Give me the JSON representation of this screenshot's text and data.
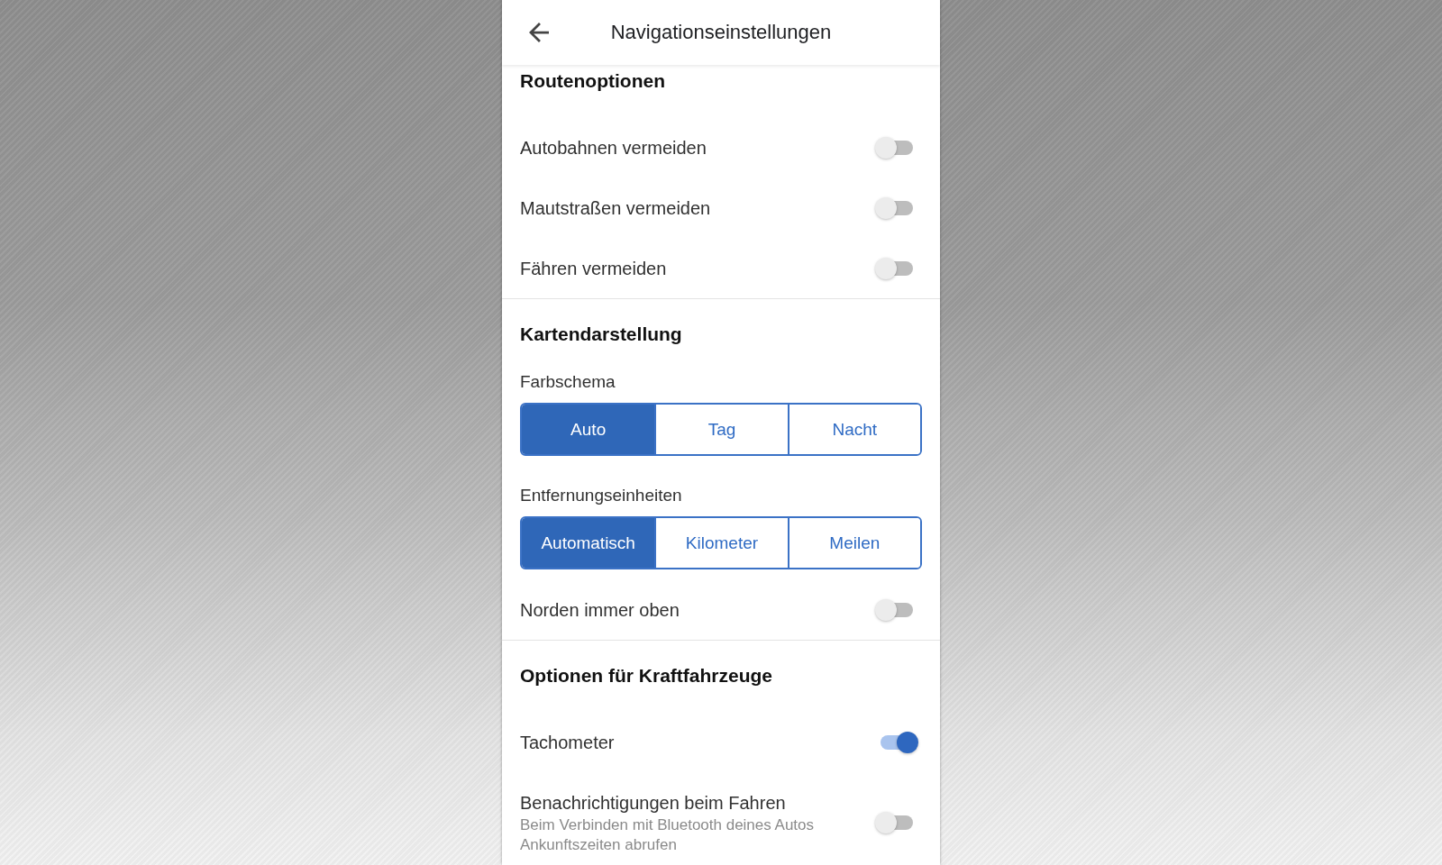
{
  "header": {
    "title": "Navigationseinstellungen"
  },
  "sections": [
    {
      "title": "Routenoptionen",
      "items": [
        {
          "kind": "toggle",
          "label": "Autobahnen vermeiden",
          "on": false
        },
        {
          "kind": "toggle",
          "label": "Mautstraßen vermeiden",
          "on": false
        },
        {
          "kind": "toggle",
          "label": "Fähren vermeiden",
          "on": false
        }
      ]
    },
    {
      "title": "Kartendarstellung",
      "items": [
        {
          "kind": "segmented",
          "label": "Farbschema",
          "options": [
            {
              "label": "Auto",
              "selected": true
            },
            {
              "label": "Tag",
              "selected": false
            },
            {
              "label": "Nacht",
              "selected": false
            }
          ]
        },
        {
          "kind": "segmented",
          "label": "Entfernungseinheiten",
          "options": [
            {
              "label": "Automatisch",
              "selected": true
            },
            {
              "label": "Kilometer",
              "selected": false
            },
            {
              "label": "Meilen",
              "selected": false
            }
          ]
        },
        {
          "kind": "toggle",
          "label": "Norden immer oben",
          "on": false
        }
      ]
    },
    {
      "title": "Optionen für Kraftfahrzeuge",
      "items": [
        {
          "kind": "toggle",
          "label": "Tachometer",
          "on": true
        },
        {
          "kind": "toggle",
          "label": "Benachrichtigungen beim Fahren",
          "description": "Beim Verbinden mit Bluetooth deines Autos Ankunftszeiten abrufen",
          "on": false
        }
      ]
    }
  ]
}
